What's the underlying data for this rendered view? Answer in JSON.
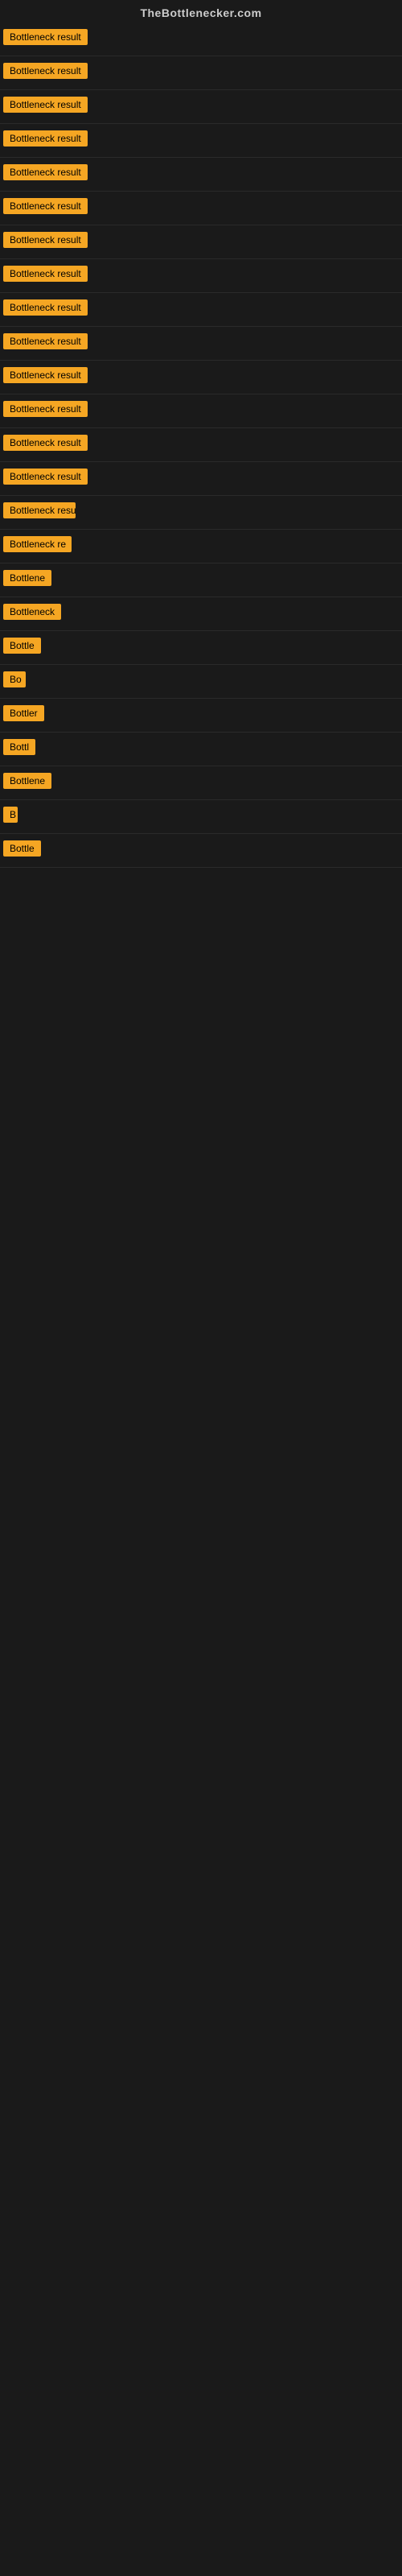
{
  "site": {
    "title": "TheBottlenecker.com"
  },
  "results": [
    {
      "id": 1,
      "label": "Bottleneck result",
      "truncated": "Bottleneck result"
    },
    {
      "id": 2,
      "label": "Bottleneck result",
      "truncated": "Bottleneck result"
    },
    {
      "id": 3,
      "label": "Bottleneck result",
      "truncated": "Bottleneck result"
    },
    {
      "id": 4,
      "label": "Bottleneck result",
      "truncated": "Bottleneck result"
    },
    {
      "id": 5,
      "label": "Bottleneck result",
      "truncated": "Bottleneck result"
    },
    {
      "id": 6,
      "label": "Bottleneck result",
      "truncated": "Bottleneck result"
    },
    {
      "id": 7,
      "label": "Bottleneck result",
      "truncated": "Bottleneck result"
    },
    {
      "id": 8,
      "label": "Bottleneck result",
      "truncated": "Bottleneck result"
    },
    {
      "id": 9,
      "label": "Bottleneck result",
      "truncated": "Bottleneck result"
    },
    {
      "id": 10,
      "label": "Bottleneck result",
      "truncated": "Bottleneck result"
    },
    {
      "id": 11,
      "label": "Bottleneck result",
      "truncated": "Bottleneck result"
    },
    {
      "id": 12,
      "label": "Bottleneck result",
      "truncated": "Bottleneck result"
    },
    {
      "id": 13,
      "label": "Bottleneck result",
      "truncated": "Bottleneck result"
    },
    {
      "id": 14,
      "label": "Bottleneck result",
      "truncated": "Bottleneck result"
    },
    {
      "id": 15,
      "label": "Bottleneck result",
      "truncated": "Bottleneck result"
    },
    {
      "id": 16,
      "label": "Bottleneck re",
      "truncated": "Bottleneck re"
    },
    {
      "id": 17,
      "label": "Bottlene",
      "truncated": "Bottlene"
    },
    {
      "id": 18,
      "label": "Bottleneck",
      "truncated": "Bottleneck"
    },
    {
      "id": 19,
      "label": "Bottle",
      "truncated": "Bottle"
    },
    {
      "id": 20,
      "label": "Bo",
      "truncated": "Bo"
    },
    {
      "id": 21,
      "label": "Bottler",
      "truncated": "Bottler"
    },
    {
      "id": 22,
      "label": "Bottl",
      "truncated": "Bottl"
    },
    {
      "id": 23,
      "label": "Bottlene",
      "truncated": "Bottlene"
    },
    {
      "id": 24,
      "label": "B",
      "truncated": "B"
    },
    {
      "id": 25,
      "label": "Bottle",
      "truncated": "Bottle"
    }
  ],
  "colors": {
    "badge_bg": "#f5a623",
    "badge_text": "#000000",
    "background": "#1a1a1a",
    "site_title": "#cccccc"
  }
}
